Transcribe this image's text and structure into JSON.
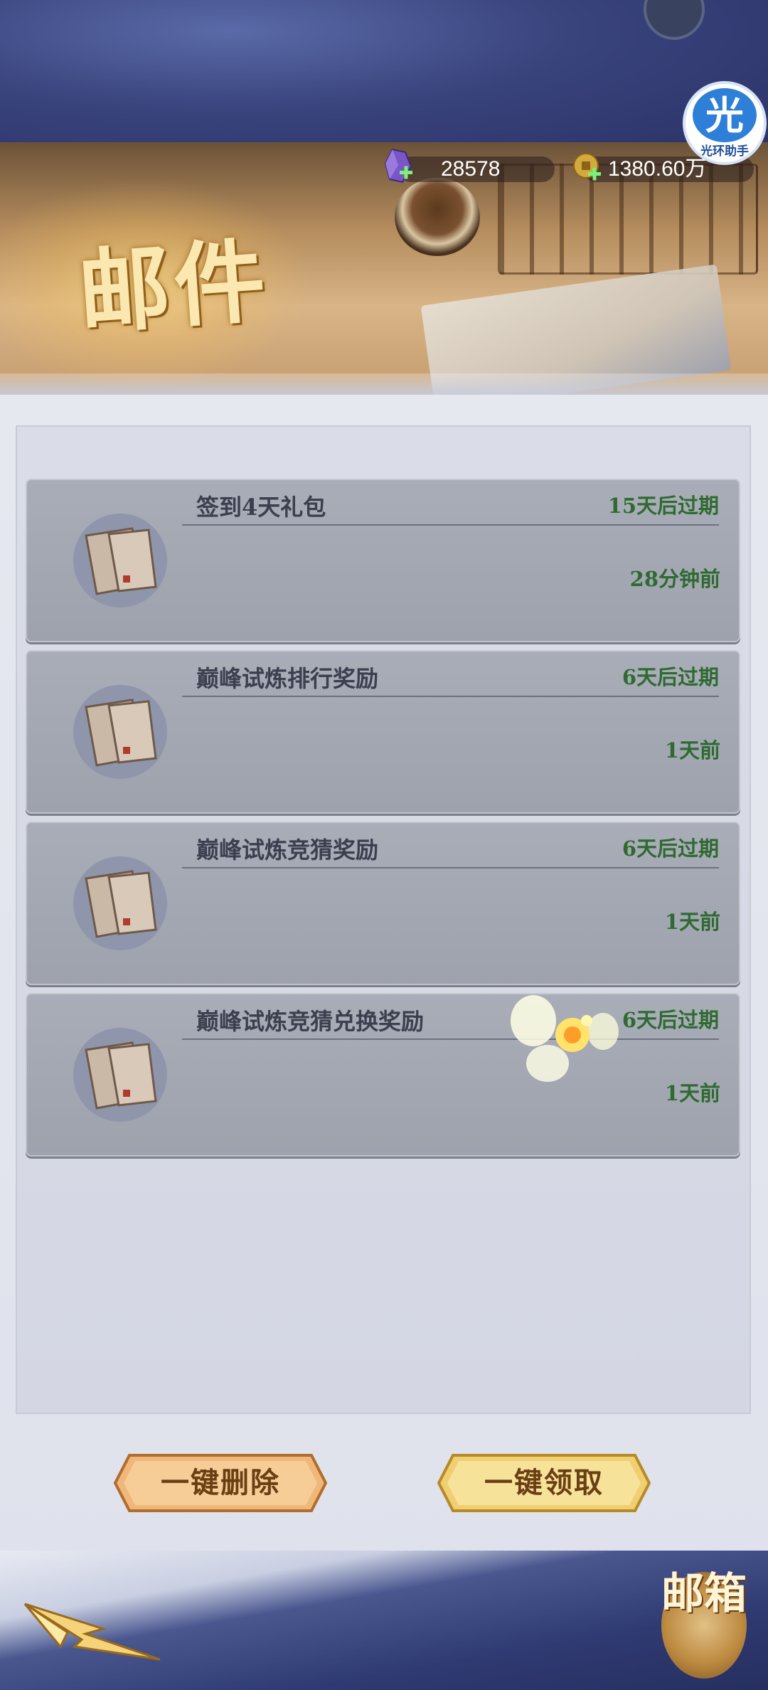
{
  "header": {
    "title": "邮件",
    "gems": "28578",
    "coins": "1380.60万",
    "helper_label": "光环助手",
    "helper_glyph": "光"
  },
  "mails": [
    {
      "title": "签到4天礼包",
      "expire": "15天后过期",
      "time": "28分钟前"
    },
    {
      "title": "巅峰试炼排行奖励",
      "expire": "6天后过期",
      "time": "1天前"
    },
    {
      "title": "巅峰试炼竞猜奖励",
      "expire": "6天后过期",
      "time": "1天前"
    },
    {
      "title": "巅峰试炼竞猜兑换奖励",
      "expire": "6天后过期",
      "time": "1天前"
    }
  ],
  "actions": {
    "delete_all": "一键删除",
    "claim_all": "一键领取"
  },
  "footer": {
    "mailbox_label": "邮箱"
  },
  "colors": {
    "expire_text": "#2f6a31",
    "card_bg": "#a9adb8",
    "button_gold": "#f3d487"
  }
}
